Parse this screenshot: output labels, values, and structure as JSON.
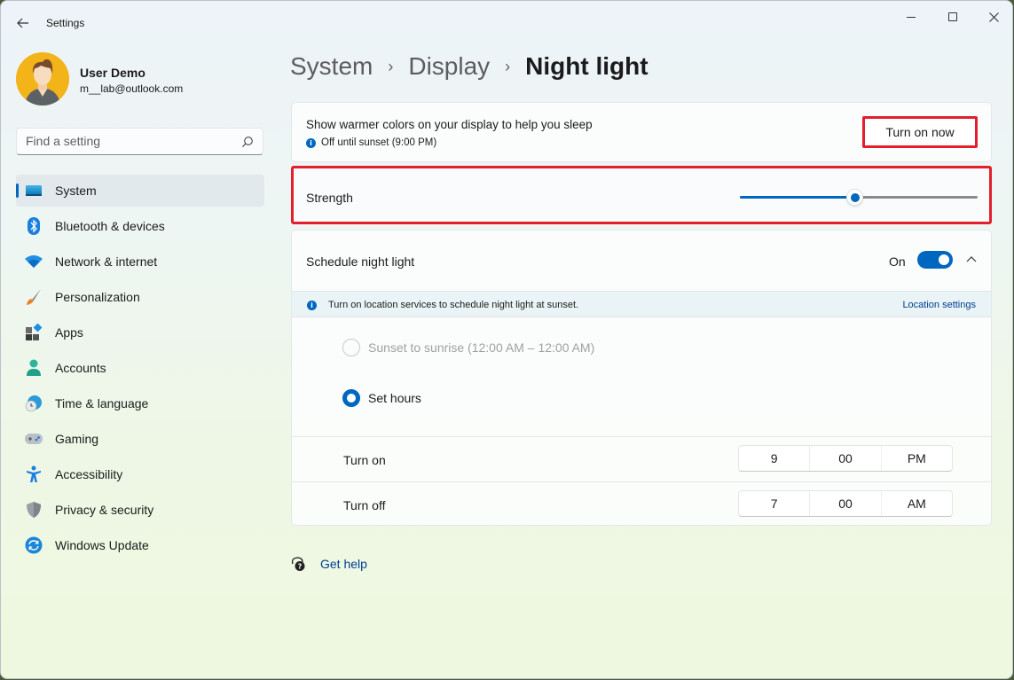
{
  "window": {
    "app_title": "Settings",
    "controls": {
      "minimize": "minimize",
      "maximize": "maximize",
      "close": "close"
    }
  },
  "profile": {
    "name": "User Demo",
    "email": "m__lab@outlook.com"
  },
  "search": {
    "placeholder": "Find a setting",
    "value": ""
  },
  "sidebar": {
    "items": [
      {
        "label": "System",
        "icon": "system-icon",
        "active": true
      },
      {
        "label": "Bluetooth & devices",
        "icon": "bluetooth-icon"
      },
      {
        "label": "Network & internet",
        "icon": "wifi-icon"
      },
      {
        "label": "Personalization",
        "icon": "brush-icon"
      },
      {
        "label": "Apps",
        "icon": "apps-icon"
      },
      {
        "label": "Accounts",
        "icon": "accounts-icon"
      },
      {
        "label": "Time & language",
        "icon": "time-language-icon"
      },
      {
        "label": "Gaming",
        "icon": "gamepad-icon"
      },
      {
        "label": "Accessibility",
        "icon": "accessibility-icon"
      },
      {
        "label": "Privacy & security",
        "icon": "shield-icon"
      },
      {
        "label": "Windows Update",
        "icon": "update-icon"
      }
    ]
  },
  "breadcrumb": {
    "items": [
      "System",
      "Display"
    ],
    "current": "Night light",
    "separator": "›"
  },
  "night_light": {
    "description": "Show warmer colors on your display to help you sleep",
    "status": "Off until sunset (9:00 PM)",
    "turn_on_button": "Turn on now",
    "strength_label": "Strength",
    "strength_percent": 48
  },
  "schedule": {
    "label": "Schedule night light",
    "toggle_state": "On",
    "toggle_on": true,
    "info_message": "Turn on location services to schedule night light at sunset.",
    "location_link": "Location settings",
    "options": [
      {
        "label": "Sunset to sunrise (12:00 AM – 12:00 AM)",
        "selected": false,
        "disabled": true
      },
      {
        "label": "Set hours",
        "selected": true,
        "disabled": false
      }
    ],
    "turn_on": {
      "label": "Turn on",
      "hour": "9",
      "minute": "00",
      "period": "PM"
    },
    "turn_off": {
      "label": "Turn off",
      "hour": "7",
      "minute": "00",
      "period": "AM"
    }
  },
  "help": {
    "label": "Get help"
  },
  "colors": {
    "accent": "#0067c0",
    "highlight_border": "#e21f2b",
    "link": "#003e92"
  }
}
